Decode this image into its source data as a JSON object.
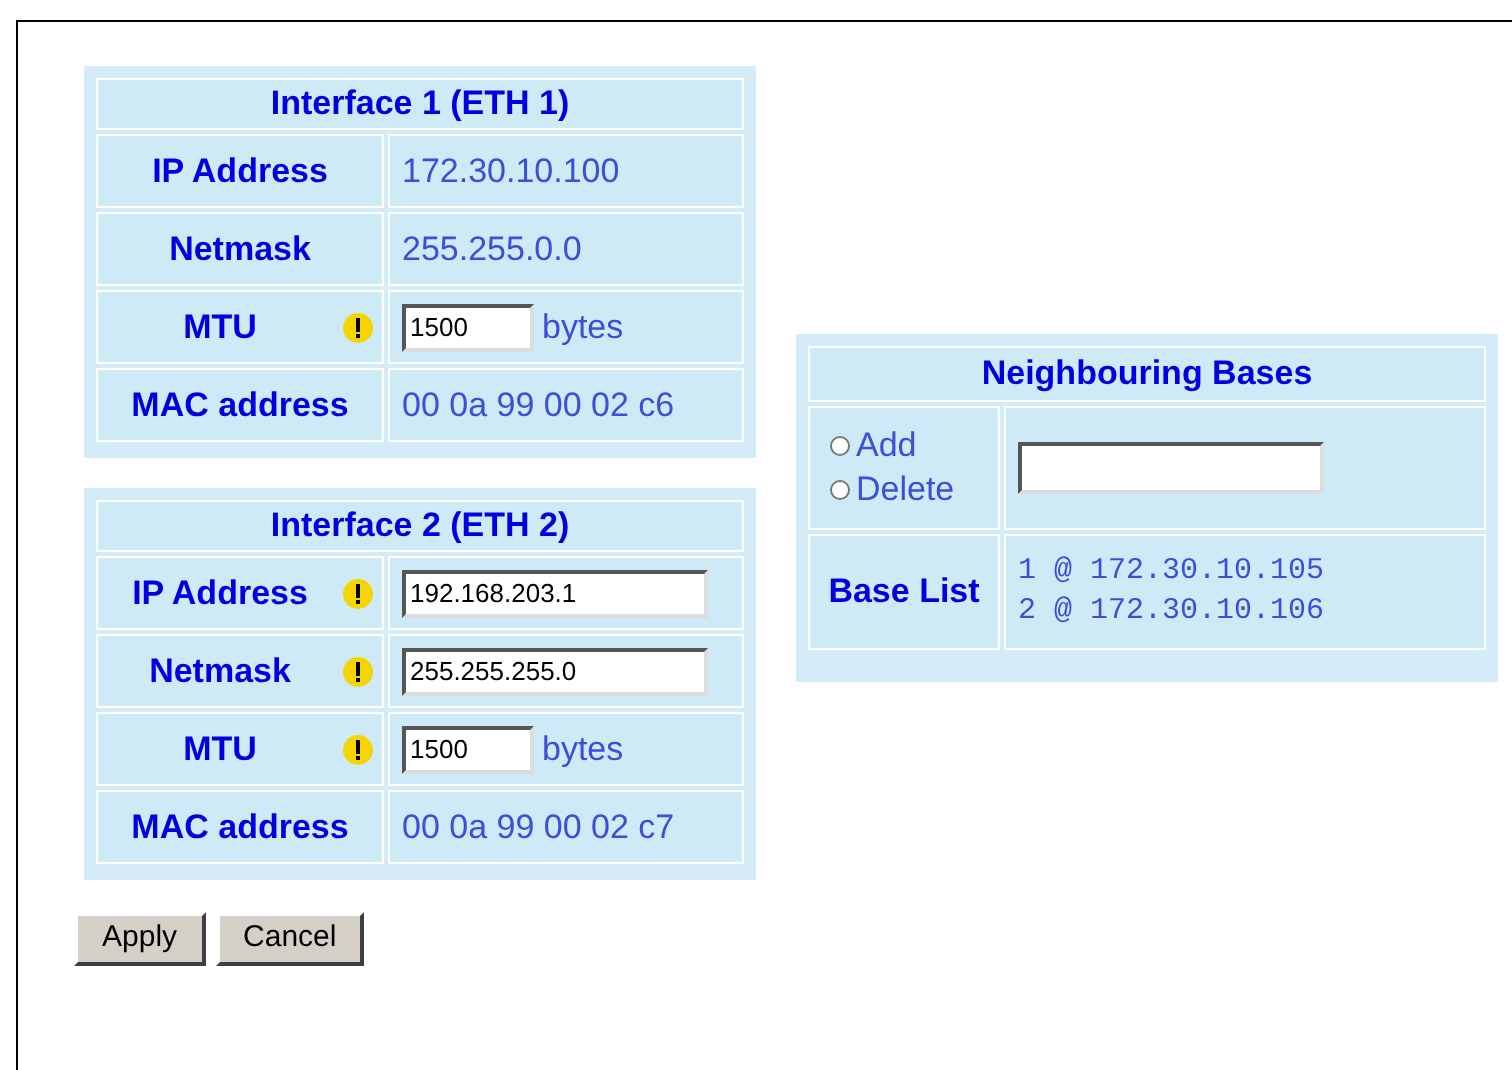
{
  "interfaces": [
    {
      "title": "Interface 1 (ETH 1)",
      "rows": [
        {
          "label": "IP Address",
          "warn": false,
          "kind": "text",
          "value": "172.30.10.100"
        },
        {
          "label": "Netmask",
          "warn": false,
          "kind": "text",
          "value": "255.255.0.0"
        },
        {
          "label": "MTU",
          "warn": true,
          "kind": "input_unit",
          "value": "1500",
          "unit": "bytes"
        },
        {
          "label": "MAC address",
          "warn": false,
          "kind": "text",
          "value": "00 0a 99 00 02 c6"
        }
      ]
    },
    {
      "title": "Interface 2 (ETH 2)",
      "rows": [
        {
          "label": "IP Address",
          "warn": true,
          "kind": "input",
          "value": "192.168.203.1"
        },
        {
          "label": "Netmask",
          "warn": true,
          "kind": "input",
          "value": "255.255.255.0"
        },
        {
          "label": "MTU",
          "warn": true,
          "kind": "input_unit",
          "value": "1500",
          "unit": "bytes"
        },
        {
          "label": "MAC address",
          "warn": false,
          "kind": "text",
          "value": "00 0a 99 00 02 c7"
        }
      ]
    }
  ],
  "neighbours": {
    "title": "Neighbouring Bases",
    "options": [
      {
        "label": "Add",
        "selected": false
      },
      {
        "label": "Delete",
        "selected": false
      }
    ],
    "base_list_label": "Base List",
    "base_list": [
      "1 @ 172.30.10.105",
      "2 @ 172.30.10.106"
    ]
  },
  "buttons": [
    "Apply",
    "Cancel"
  ]
}
